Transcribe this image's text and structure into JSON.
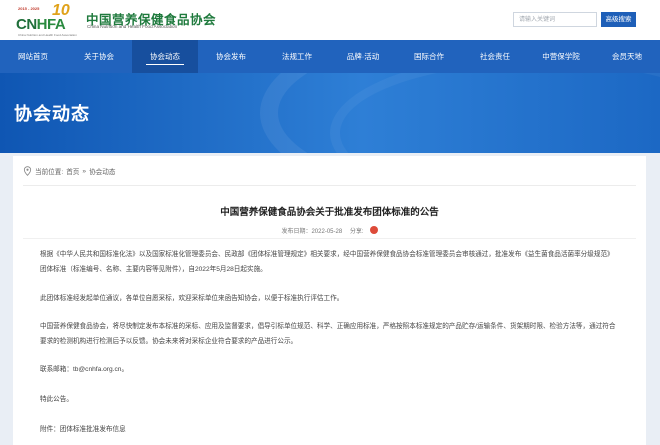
{
  "header": {
    "logo": {
      "years": "2015 - 2025",
      "ten": "10",
      "cn_prefix": "CN",
      "fa_suffix": "HFA",
      "sub": "China Nutrition and Health Food Association"
    },
    "org_name_cn": "中国营养保健食品协会",
    "org_name_en": "China Nutrition and Health Food Association",
    "search_placeholder": "请输入关键词",
    "advanced_search_label": "高级搜索"
  },
  "nav": {
    "items": [
      {
        "label": "网站首页"
      },
      {
        "label": "关于协会"
      },
      {
        "label": "协会动态"
      },
      {
        "label": "协会发布"
      },
      {
        "label": "法规工作"
      },
      {
        "label": "品牌·活动"
      },
      {
        "label": "国际合作"
      },
      {
        "label": "社会责任"
      },
      {
        "label": "中营保学院"
      },
      {
        "label": "会员天地"
      }
    ],
    "active_index": 2
  },
  "banner": {
    "title": "协会动态"
  },
  "breadcrumb": {
    "current_label": "当前位置:",
    "home": "首页",
    "separator": "»",
    "section": "协会动态"
  },
  "article": {
    "title": "中国营养保健食品协会关于批准发布团体标准的公告",
    "publish_time": "发布日期：2022-05-28",
    "share_label": "分享:",
    "paragraphs": [
      "根据《中华人民共和国标准化法》以及国家标准化管理委员会、民政部《团体标准管理规定》相关要求，经中国营养保健食品协会标准管理委员会审核通过，批准发布《益生菌食品活菌率分级规范》团体标准（标准编号、名称、主要内容等见附件），自2022年5月28日起实施。",
      "此团体标准经发起单位通议，各单位自愿采标，欢迎采标单位来函告知协会，以便于标准执行评估工作。",
      "中国营养保健食品协会，将尽快制定发布本标准的采标、应用及监督要求，倡导引标单位规范、科学、正确应用标准，严格按照本标准规定的产品贮存/运输条件、货架期时限、检验方法等，通过符合要求的检测机构进行检测后予以反馈。协会未来将对采标企业符合要求的产品进行公示。",
      "联系邮箱：tb@cnhfa.org.cn。",
      "特此公告。",
      "附件：团体标准批准发布信息"
    ]
  },
  "colors": {
    "nav_bg": "#2163bd",
    "nav_active": "#174f9e",
    "brand_green": "#1f7a3d",
    "button_blue": "#1e5fb8"
  }
}
